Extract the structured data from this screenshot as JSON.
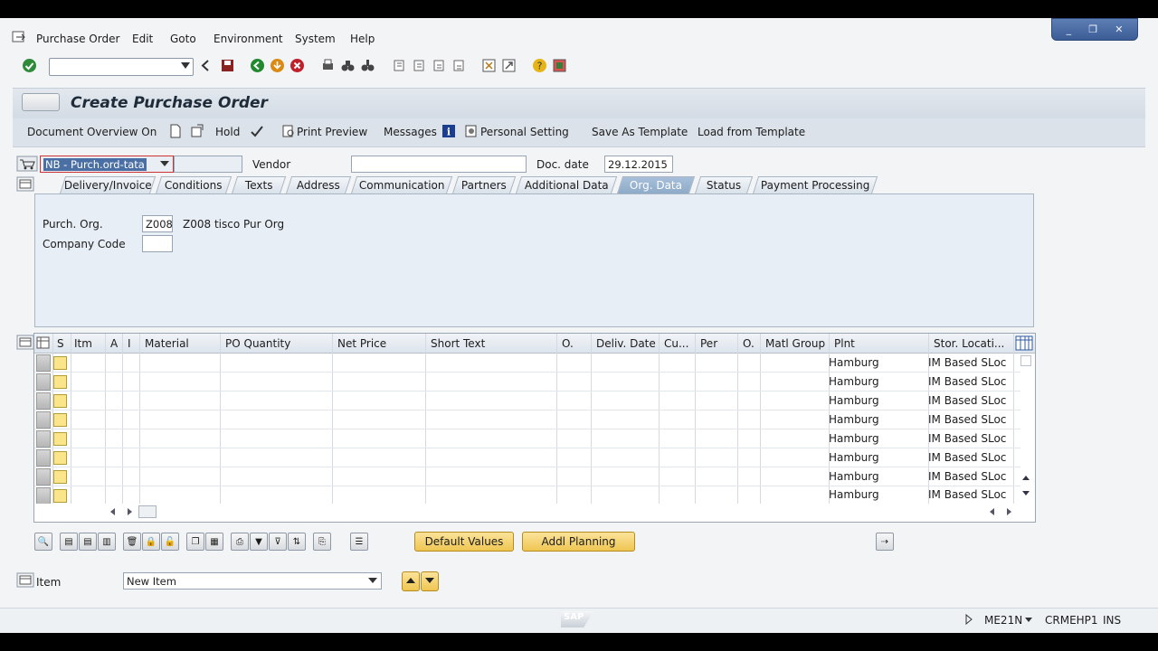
{
  "window_controls": {
    "minimize": "_",
    "restore": "❐",
    "close": "✕"
  },
  "menubar": {
    "items": [
      {
        "label": "Purchase Order"
      },
      {
        "label": "Edit"
      },
      {
        "label": "Goto"
      },
      {
        "label": "Environment"
      },
      {
        "label": "System"
      },
      {
        "label": "Help"
      }
    ]
  },
  "toolbar": {
    "command_value": ""
  },
  "page": {
    "title": "Create Purchase Order"
  },
  "app_toolbar": {
    "doc_overview": "Document Overview On",
    "hold": "Hold",
    "print_preview": "Print Preview",
    "messages": "Messages",
    "personal_setting": "Personal Setting",
    "save_template": "Save As Template",
    "load_template": "Load from Template"
  },
  "header": {
    "doc_type": "NB - Purch.ord-tata",
    "vendor_label": "Vendor",
    "vendor_value": "",
    "doc_date_label": "Doc. date",
    "doc_date_value": "29.12.2015"
  },
  "tabs": [
    {
      "label": "Delivery/Invoice"
    },
    {
      "label": "Conditions"
    },
    {
      "label": "Texts"
    },
    {
      "label": "Address"
    },
    {
      "label": "Communication"
    },
    {
      "label": "Partners"
    },
    {
      "label": "Additional Data"
    },
    {
      "label": "Org. Data",
      "active": true
    },
    {
      "label": "Status"
    },
    {
      "label": "Payment Processing"
    }
  ],
  "org_data": {
    "purch_org_label": "Purch. Org.",
    "purch_org_value": "Z008",
    "purch_org_desc": "Z008 tisco Pur Org",
    "company_code_label": "Company Code",
    "company_code_value": ""
  },
  "grid": {
    "columns": [
      "S",
      "Itm",
      "A",
      "I",
      "Material",
      "PO Quantity",
      "Net Price",
      "Short Text",
      "O.",
      "Deliv. Date",
      "Cu...",
      "Per",
      "O.",
      "Matl Group",
      "Plnt",
      "Stor. Locati..."
    ],
    "rows": [
      {
        "plant": "Hamburg",
        "sloc": "IM Based SLoc"
      },
      {
        "plant": "Hamburg",
        "sloc": "IM Based SLoc"
      },
      {
        "plant": "Hamburg",
        "sloc": "IM Based SLoc"
      },
      {
        "plant": "Hamburg",
        "sloc": "IM Based SLoc"
      },
      {
        "plant": "Hamburg",
        "sloc": "IM Based SLoc"
      },
      {
        "plant": "Hamburg",
        "sloc": "IM Based SLoc"
      },
      {
        "plant": "Hamburg",
        "sloc": "IM Based SLoc"
      },
      {
        "plant": "Hamburg",
        "sloc": "IM Based SLoc"
      }
    ]
  },
  "bottom": {
    "default_values": "Default Values",
    "addl_planning": "Addl Planning",
    "item_label": "Item",
    "item_select": "New Item"
  },
  "statusbar": {
    "transaction": "ME21N",
    "system": "CRMEHP1",
    "mode": "INS",
    "sap_logo": "SAP"
  },
  "colors": {
    "accent": "#8eabc9",
    "yellow_button": "#efc652"
  }
}
